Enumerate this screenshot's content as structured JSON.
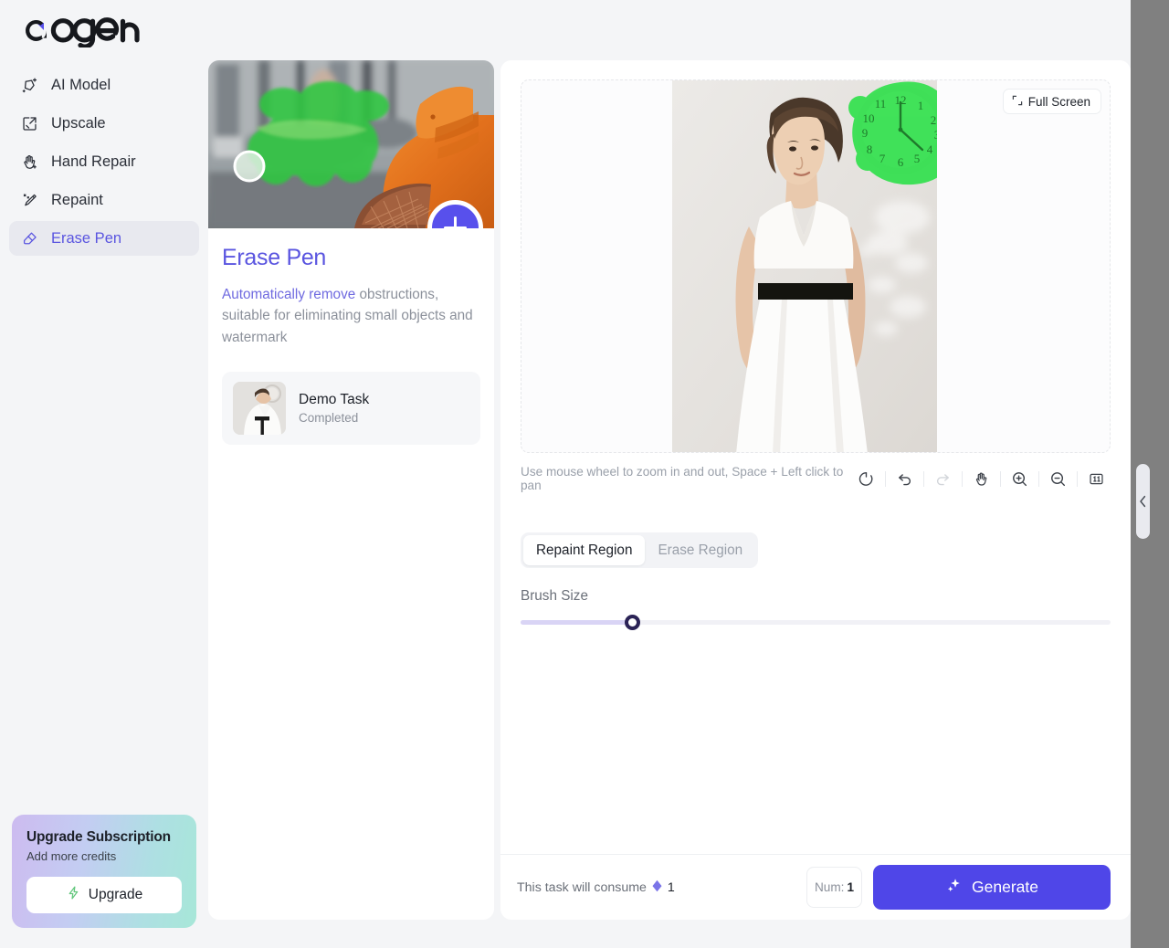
{
  "brand": {
    "name": "GOGEN",
    "accent": "#5850ec"
  },
  "sidebar": {
    "items": [
      {
        "label": "AI Model",
        "icon": "ai-model-icon"
      },
      {
        "label": "Upscale",
        "icon": "upscale-icon"
      },
      {
        "label": "Hand Repair",
        "icon": "hand-repair-icon"
      },
      {
        "label": "Repaint",
        "icon": "repaint-icon"
      },
      {
        "label": "Erase Pen",
        "icon": "erase-pen-icon",
        "active": true
      }
    ],
    "upgrade": {
      "title": "Upgrade Subscription",
      "subtitle": "Add more credits",
      "button_label": "Upgrade"
    }
  },
  "tool_card": {
    "title": "Erase Pen",
    "desc_highlight": "Automatically remove",
    "desc_rest": " obstructions, suitable for eliminating small objects and watermark",
    "add_button_label": "+",
    "task": {
      "name": "Demo Task",
      "status": "Completed"
    }
  },
  "canvas": {
    "fullscreen_label": "Full Screen",
    "hint": "Use mouse wheel to zoom in and out, Space + Left click to pan",
    "tools": [
      {
        "name": "reset-icon",
        "label": "Reset",
        "disabled": false
      },
      {
        "name": "undo-icon",
        "label": "Undo",
        "disabled": false
      },
      {
        "name": "redo-icon",
        "label": "Redo",
        "disabled": true
      },
      {
        "name": "pan-hand-icon",
        "label": "Pan",
        "disabled": false
      },
      {
        "name": "zoom-in-icon",
        "label": "Zoom In",
        "disabled": false
      },
      {
        "name": "zoom-out-icon",
        "label": "Zoom Out",
        "disabled": false
      },
      {
        "name": "actual-size-icon",
        "label": "1:1",
        "disabled": false
      }
    ]
  },
  "controls": {
    "tabs": [
      {
        "label": "Repaint Region",
        "active": true
      },
      {
        "label": "Erase Region",
        "active": false
      }
    ],
    "brush_size_label": "Brush Size",
    "brush_size_percent": 19
  },
  "footer": {
    "consume_text": "This task will consume",
    "consume_credits": "1",
    "num_label": "Num:",
    "num_value": "1",
    "generate_label": "Generate"
  }
}
